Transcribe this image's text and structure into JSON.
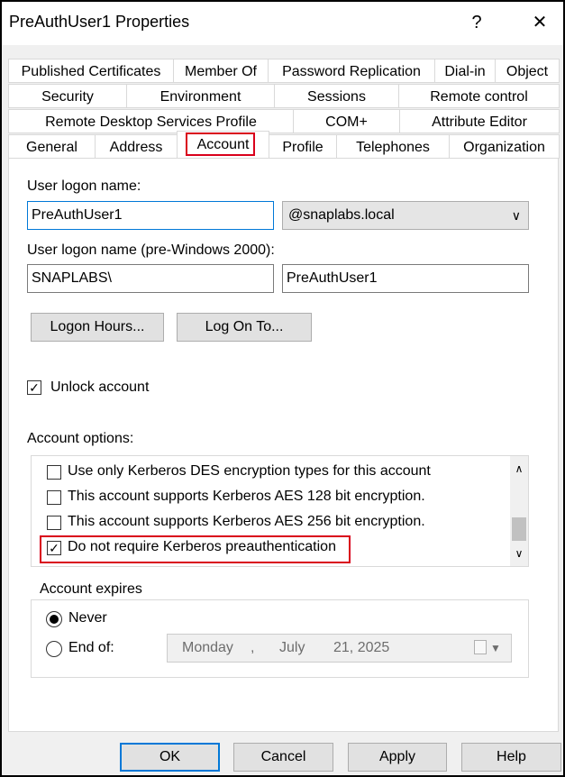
{
  "window": {
    "title": "PreAuthUser1 Properties",
    "help_glyph": "?",
    "close_glyph": "✕"
  },
  "tabs": {
    "row1": [
      "Published Certificates",
      "Member Of",
      "Password Replication",
      "Dial-in",
      "Object"
    ],
    "row2": [
      "Security",
      "Environment",
      "Sessions",
      "Remote control"
    ],
    "row3": [
      "Remote Desktop Services Profile",
      "COM+",
      "Attribute Editor"
    ],
    "row4": [
      "General",
      "Address",
      "Account",
      "Profile",
      "Telephones",
      "Organization"
    ],
    "active": "Account"
  },
  "account": {
    "logon_name_label": "User logon name:",
    "logon_name_value": "PreAuthUser1",
    "domain_value": "@snaplabs.local",
    "prewin_label": "User logon name (pre-Windows 2000):",
    "prewin_domain": "SNAPLABS\\",
    "prewin_user": "PreAuthUser1",
    "logon_hours_button": "Logon Hours...",
    "log_on_to_button": "Log On To...",
    "unlock_label": "Unlock account",
    "unlock_checked": true,
    "options_label": "Account options:",
    "options": [
      {
        "label": "Use only Kerberos DES encryption types for this account",
        "checked": false
      },
      {
        "label": "This account supports Kerberos AES 128 bit encryption.",
        "checked": false
      },
      {
        "label": "This account supports Kerberos AES 256 bit encryption.",
        "checked": false
      },
      {
        "label": "Do not require Kerberos preauthentication",
        "checked": true
      }
    ],
    "expires": {
      "group_label": "Account expires",
      "never_label": "Never",
      "endof_label": "End of:",
      "selected": "Never",
      "date_weekday": "Monday",
      "date_sep": ",",
      "date_month": "July",
      "date_day_year": "21, 2025"
    }
  },
  "footer": {
    "ok": "OK",
    "cancel": "Cancel",
    "apply": "Apply",
    "help": "Help"
  },
  "colors": {
    "highlight": "#d9001b",
    "focus": "#0078d7"
  }
}
